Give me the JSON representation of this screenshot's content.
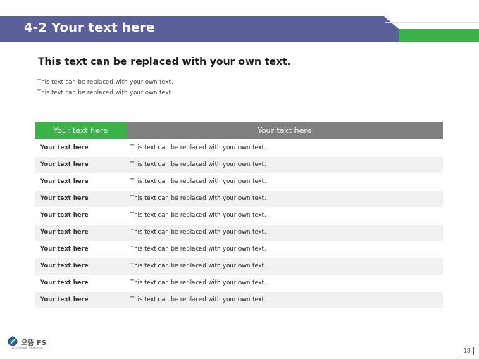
{
  "header": {
    "title": "4-2 Your text here"
  },
  "content": {
    "subtitle": "This text can be replaced with your own text.",
    "paragraph_lines": [
      "This text can be replaced with your own text.",
      "This text can be replaced with your own text."
    ]
  },
  "table": {
    "headers": [
      "Your text here",
      "Your text here"
    ],
    "rows": [
      [
        "Your text here",
        "This text can be replaced with your own text."
      ],
      [
        "Your text here",
        "This text can be replaced with your own text."
      ],
      [
        "Your text here",
        "This text can be replaced with your own text."
      ],
      [
        "Your text here",
        "This text can be replaced with your own text."
      ],
      [
        "Your text here",
        "This text can be replaced with your own text."
      ],
      [
        "Your text here",
        "This text can be replaced with your own text."
      ],
      [
        "Your text here",
        "This text can be replaced with your own text."
      ],
      [
        "Your text here",
        "This text can be replaced with your own text."
      ],
      [
        "Your text here",
        "This text can be replaced with your own text."
      ],
      [
        "Your text here",
        "This text can be replaced with your own text."
      ]
    ]
  },
  "footer": {
    "logo_text": "으뜸 FS",
    "logo_subtext": "NO1FOOD SERVICE",
    "logo_icon": "leaf-logo-icon",
    "page_number": "18"
  },
  "colors": {
    "header_blue": "#5b5f9a",
    "accent_green": "#3bb24a",
    "header_gray": "#808080",
    "row_alt": "#f1f1f1"
  }
}
